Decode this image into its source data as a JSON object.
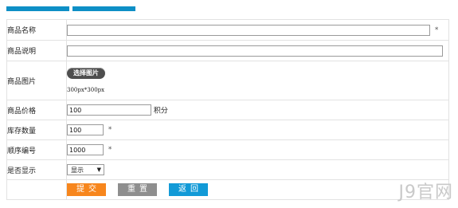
{
  "fields": {
    "name": {
      "label": "商品名称",
      "value": "",
      "required_mark": "*"
    },
    "description": {
      "label": "商品说明",
      "value": ""
    },
    "image": {
      "label": "商品图片",
      "button_label": "选择图片",
      "size_hint": "300px*300px"
    },
    "price": {
      "label": "商品价格",
      "value": "100",
      "unit": "积分"
    },
    "stock": {
      "label": "库存数量",
      "value": "100",
      "required_mark": "*"
    },
    "sort_order": {
      "label": "顺序编号",
      "value": "1000",
      "required_mark": "*"
    },
    "visibility": {
      "label": "是否显示",
      "selected": "显示",
      "caret": "▼"
    }
  },
  "actions": {
    "submit": "提交",
    "reset": "重置",
    "back": "返回"
  },
  "watermark": "J9官网",
  "colors": {
    "tab": "#0e8fc6",
    "submit": "#f7861d",
    "reset": "#8e8e8e",
    "back": "#129ad7"
  }
}
